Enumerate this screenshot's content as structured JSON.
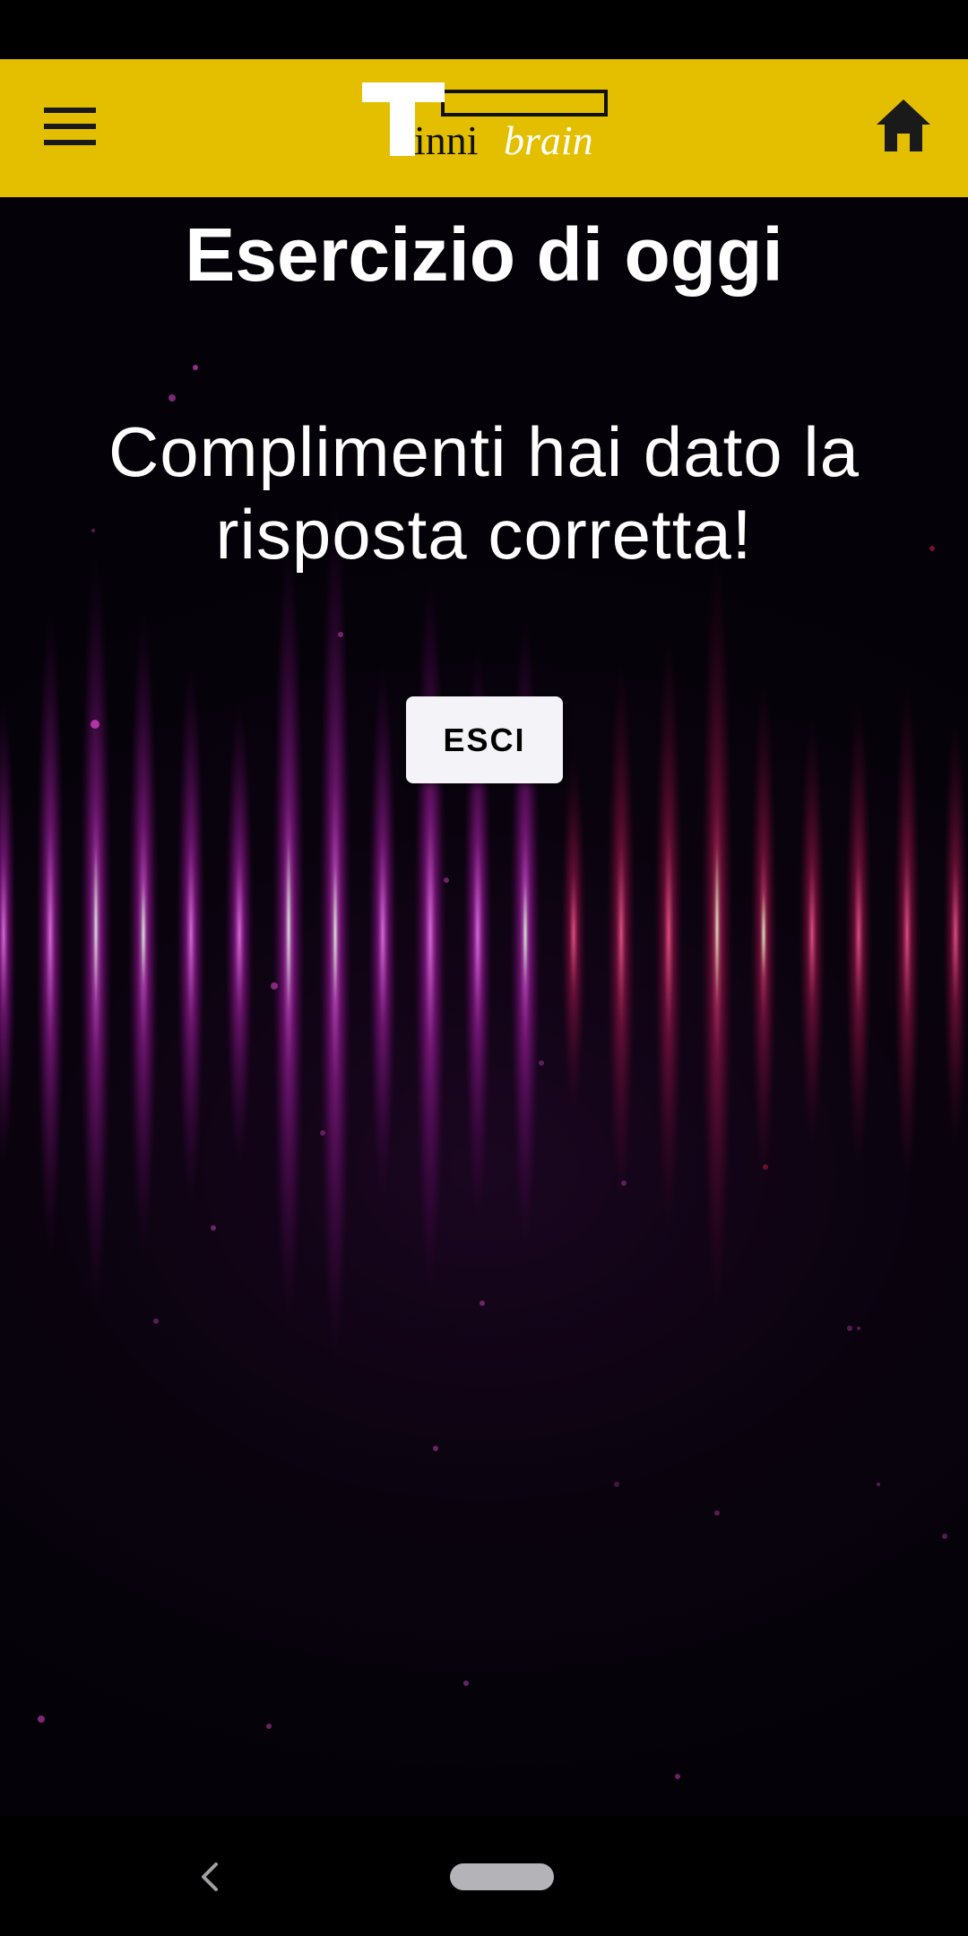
{
  "app": {
    "logo_text": "Tinnibrain"
  },
  "header": {
    "menu_icon": "menu-icon",
    "home_icon": "home-icon"
  },
  "main": {
    "title": "Esercizio di oggi",
    "message": "Complimenti hai dato la risposta corretta!",
    "exit_button_label": "ESCI"
  },
  "system_nav": {
    "back_icon": "back-chevron-icon",
    "home_pill": "home-pill-icon"
  },
  "colors": {
    "app_bar": "#e4bf00",
    "background": "#000000",
    "accent_glow": "#c020c0",
    "button_bg": "#f4f4f8"
  }
}
